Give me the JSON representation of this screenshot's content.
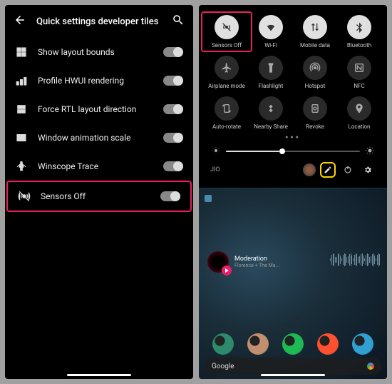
{
  "left": {
    "title": "Quick settings developer tiles",
    "rows": [
      {
        "label": "Show layout bounds",
        "on": true
      },
      {
        "label": "Profile HWUI rendering",
        "on": true
      },
      {
        "label": "Force RTL layout direction",
        "on": true
      },
      {
        "label": "Window animation scale",
        "on": true
      },
      {
        "label": "Winscope Trace",
        "on": true
      },
      {
        "label": "Sensors Off",
        "on": true,
        "highlight": true
      }
    ]
  },
  "right": {
    "tiles": [
      {
        "label": "Sensors Off",
        "active": true,
        "highlight": true,
        "icon": "sensors-off"
      },
      {
        "label": "Wi-Fi",
        "active": true,
        "icon": "wifi"
      },
      {
        "label": "Mobile data",
        "active": true,
        "icon": "mobile-data"
      },
      {
        "label": "Bluetooth",
        "active": true,
        "icon": "bluetooth"
      },
      {
        "label": "Airplane mode",
        "active": false,
        "icon": "airplane"
      },
      {
        "label": "Flashlight",
        "active": false,
        "icon": "flashlight"
      },
      {
        "label": "Hotspot",
        "active": false,
        "icon": "hotspot"
      },
      {
        "label": "NFC",
        "active": false,
        "icon": "nfc"
      },
      {
        "label": "Auto-rotate",
        "active": false,
        "icon": "rotate"
      },
      {
        "label": "Nearby Share",
        "active": false,
        "icon": "nearby"
      },
      {
        "label": "Revoke",
        "active": false,
        "icon": "revoke"
      },
      {
        "label": "Location",
        "active": false,
        "icon": "location"
      }
    ],
    "carrier": "JIO",
    "brightness_pct": 40,
    "music": {
      "song": "Moderation",
      "artist": "Florence + The Ma..."
    },
    "search_label": "Google",
    "app_colors": [
      "#2d8a6a",
      "#c09070",
      "#1db954",
      "#ff5030",
      "#30a0d0"
    ]
  },
  "highlight_color": "#e91e63",
  "edit_highlight_color": "#ffd600"
}
